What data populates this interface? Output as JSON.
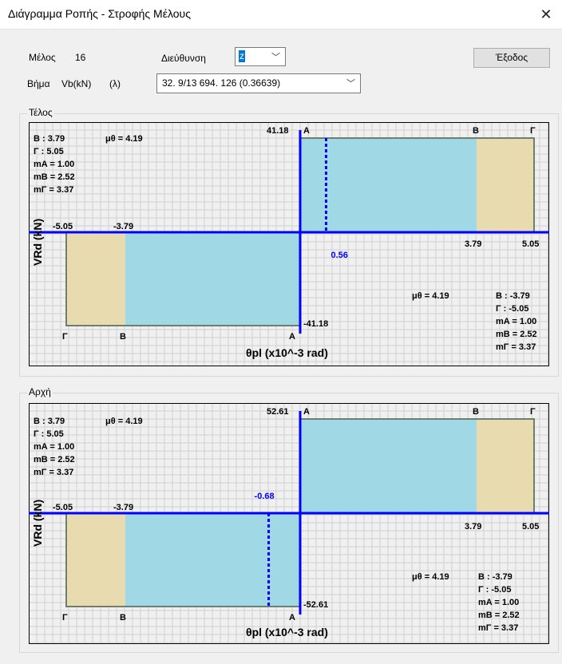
{
  "window": {
    "title": "Διάγραμμα Ροπής - Στροφής Μέλους",
    "close_glyph": "✕"
  },
  "controls": {
    "member_label": "Μέλος",
    "member_value": "16",
    "direction_label": "Διεύθυνση",
    "direction_value": "z",
    "exit_label": "Έξοδος",
    "step_label": "Βήμα",
    "vb_label": "Vb(kN)",
    "lambda_label": "(λ)",
    "step_value": "32. 9/13 694. 126 (0.36639)"
  },
  "colors": {
    "axis": "#0000ff",
    "fill_ab": "#a0d8e6",
    "fill_bg": "#e8dbb0",
    "outline": "#6f7f6f",
    "grid": "#d0d0d0",
    "marker_label": "#0000ff"
  },
  "panels": [
    {
      "id": "telos",
      "group_label": "Τέλος",
      "ylabel": "VRd (kN)",
      "xlabel": "θpl (x10^-3 rad)",
      "top_value": "41.18",
      "bottom_value": "-41.18",
      "left_info": [
        "B : 3.79",
        "Γ : 5.05",
        "mA = 1.00",
        "mB = 2.52",
        "mΓ = 3.37"
      ],
      "left_mu": "μθ = 4.19",
      "right_info": [
        "B : -3.79",
        "Γ : -5.05",
        "mA = 1.00",
        "mB = 2.52",
        "mΓ = 3.37"
      ],
      "right_mu": "μθ = 4.19",
      "xneg": [
        "-5.05",
        "-3.79"
      ],
      "xpos": [
        "3.79",
        "5.05"
      ],
      "top_letters": [
        "A",
        "B",
        "Γ"
      ],
      "bottom_letters": [
        "Γ",
        "B",
        "A"
      ],
      "marker_value": 0.56,
      "marker_label": "0.56"
    },
    {
      "id": "arxi",
      "group_label": "Αρχή",
      "ylabel": "VRd (kN)",
      "xlabel": "θpl (x10^-3 rad)",
      "top_value": "52.61",
      "bottom_value": "-52.61",
      "left_info": [
        "B : 3.79",
        "Γ : 5.05",
        "mA = 1.00",
        "mB = 2.52",
        "mΓ = 3.37"
      ],
      "left_mu": "μθ = 4.19",
      "right_info": [
        "B : -3.79",
        "Γ : -5.05",
        "mA = 1.00",
        "mB = 2.52",
        "mΓ = 3.37"
      ],
      "right_mu": "μθ = 4.19",
      "xneg": [
        "-5.05",
        "-3.79"
      ],
      "xpos": [
        "3.79",
        "5.05"
      ],
      "top_letters": [
        "A",
        "B",
        "Γ"
      ],
      "bottom_letters": [
        "Γ",
        "B",
        "A"
      ],
      "marker_value": -0.68,
      "marker_label": "-0.68"
    }
  ]
}
